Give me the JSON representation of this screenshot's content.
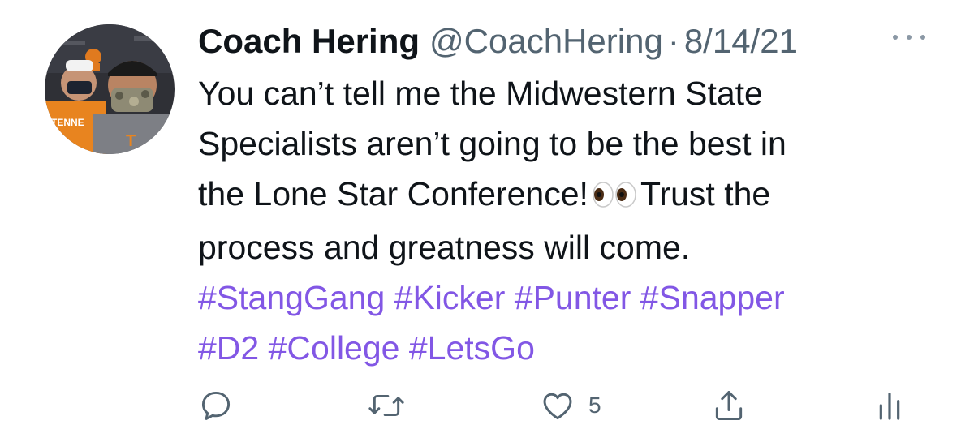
{
  "tweet": {
    "author": {
      "display_name": "Coach Hering",
      "handle": "@CoachHering"
    },
    "separator": "·",
    "date": "8/14/21",
    "text_lines": [
      "You can’t tell me the Midwestern State",
      "Specialists aren’t going to be the best in"
    ],
    "text_line3_before": "the Lone Star Conference!",
    "emoji": "eyes",
    "text_line3_after": "Trust the",
    "text_line4": "process and greatness will come.",
    "hashtags": [
      "#StangGang",
      "#Kicker",
      "#Punter",
      "#Snapper",
      "#D2",
      "#College",
      "#LetsGo"
    ]
  },
  "actions": {
    "reply_icon": "reply-icon",
    "retweet_icon": "retweet-icon",
    "like_icon": "heart-icon",
    "like_count": "5",
    "share_icon": "share-icon",
    "analytics_icon": "analytics-icon"
  },
  "colors": {
    "text": "#0f1419",
    "muted": "#536471",
    "hashtag": "#8257e5",
    "icon": "#536471"
  }
}
